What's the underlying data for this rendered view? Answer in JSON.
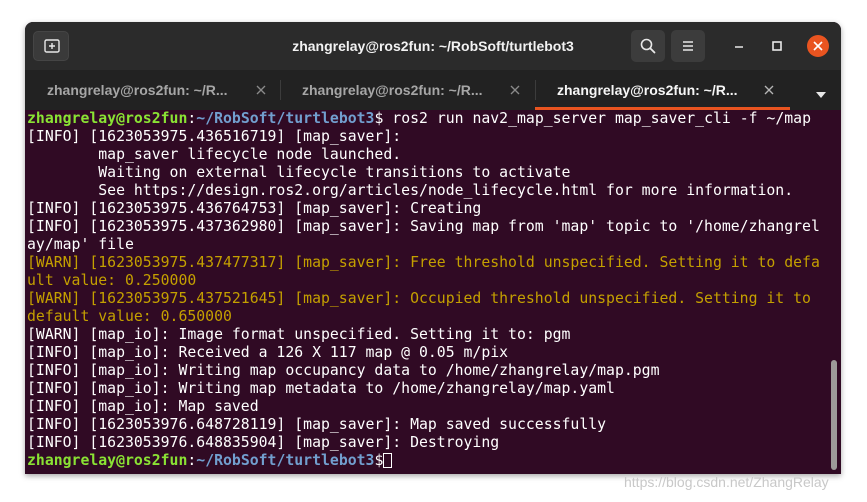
{
  "window": {
    "title": "zhangrelay@ros2fun: ~/RobSoft/turtlebot3"
  },
  "tabs": [
    {
      "label": "zhangrelay@ros2fun: ~/R...",
      "active": false
    },
    {
      "label": "zhangrelay@ros2fun: ~/R...",
      "active": false
    },
    {
      "label": "zhangrelay@ros2fun: ~/R...",
      "active": true
    }
  ],
  "terminal": {
    "prompt_user": "zhangrelay@ros2fun",
    "prompt_path": "~/RobSoft/turtlebot3",
    "command": "ros2 run nav2_map_server map_saver_cli -f ~/map",
    "lines": [
      {
        "type": "info",
        "text": "[INFO] [1623053975.436516719] [map_saver]:"
      },
      {
        "type": "info",
        "text": "        map_saver lifecycle node launched."
      },
      {
        "type": "info",
        "text": "        Waiting on external lifecycle transitions to activate"
      },
      {
        "type": "info",
        "text": "        See https://design.ros2.org/articles/node_lifecycle.html for more information."
      },
      {
        "type": "info",
        "text": "[INFO] [1623053975.436764753] [map_saver]: Creating"
      },
      {
        "type": "info",
        "text": "[INFO] [1623053975.437362980] [map_saver]: Saving map from 'map' topic to '/home/zhangrel"
      },
      {
        "type": "info",
        "text": "ay/map' file"
      },
      {
        "type": "warn",
        "text": "[WARN] [1623053975.437477317] [map_saver]: Free threshold unspecified. Setting it to defa"
      },
      {
        "type": "warn",
        "text": "ult value: 0.250000"
      },
      {
        "type": "warn",
        "text": "[WARN] [1623053975.437521645] [map_saver]: Occupied threshold unspecified. Setting it to "
      },
      {
        "type": "warn",
        "text": "default value: 0.650000"
      },
      {
        "type": "info",
        "text": "[WARN] [map_io]: Image format unspecified. Setting it to: pgm"
      },
      {
        "type": "info",
        "text": "[INFO] [map_io]: Received a 126 X 117 map @ 0.05 m/pix"
      },
      {
        "type": "info",
        "text": "[INFO] [map_io]: Writing map occupancy data to /home/zhangrelay/map.pgm"
      },
      {
        "type": "info",
        "text": "[INFO] [map_io]: Writing map metadata to /home/zhangrelay/map.yaml"
      },
      {
        "type": "info",
        "text": "[INFO] [map_io]: Map saved"
      },
      {
        "type": "info",
        "text": "[INFO] [1623053976.648728119] [map_saver]: Map saved successfully"
      },
      {
        "type": "info",
        "text": "[INFO] [1623053976.648835904] [map_saver]: Destroying"
      }
    ]
  },
  "watermark": "https://blog.csdn.net/ZhangRelay",
  "icons": {
    "new_tab": "new-tab-icon",
    "search": "search-icon",
    "menu": "hamburger-menu-icon",
    "minimize": "minimize-icon",
    "maximize": "maximize-icon",
    "close": "close-icon",
    "tabs_menu": "chevron-down-icon"
  },
  "colors": {
    "terminal_bg": "#300a24",
    "prompt_user": "#8ae234",
    "prompt_path": "#729fcf",
    "warn": "#c4a000",
    "accent": "#e95420"
  }
}
